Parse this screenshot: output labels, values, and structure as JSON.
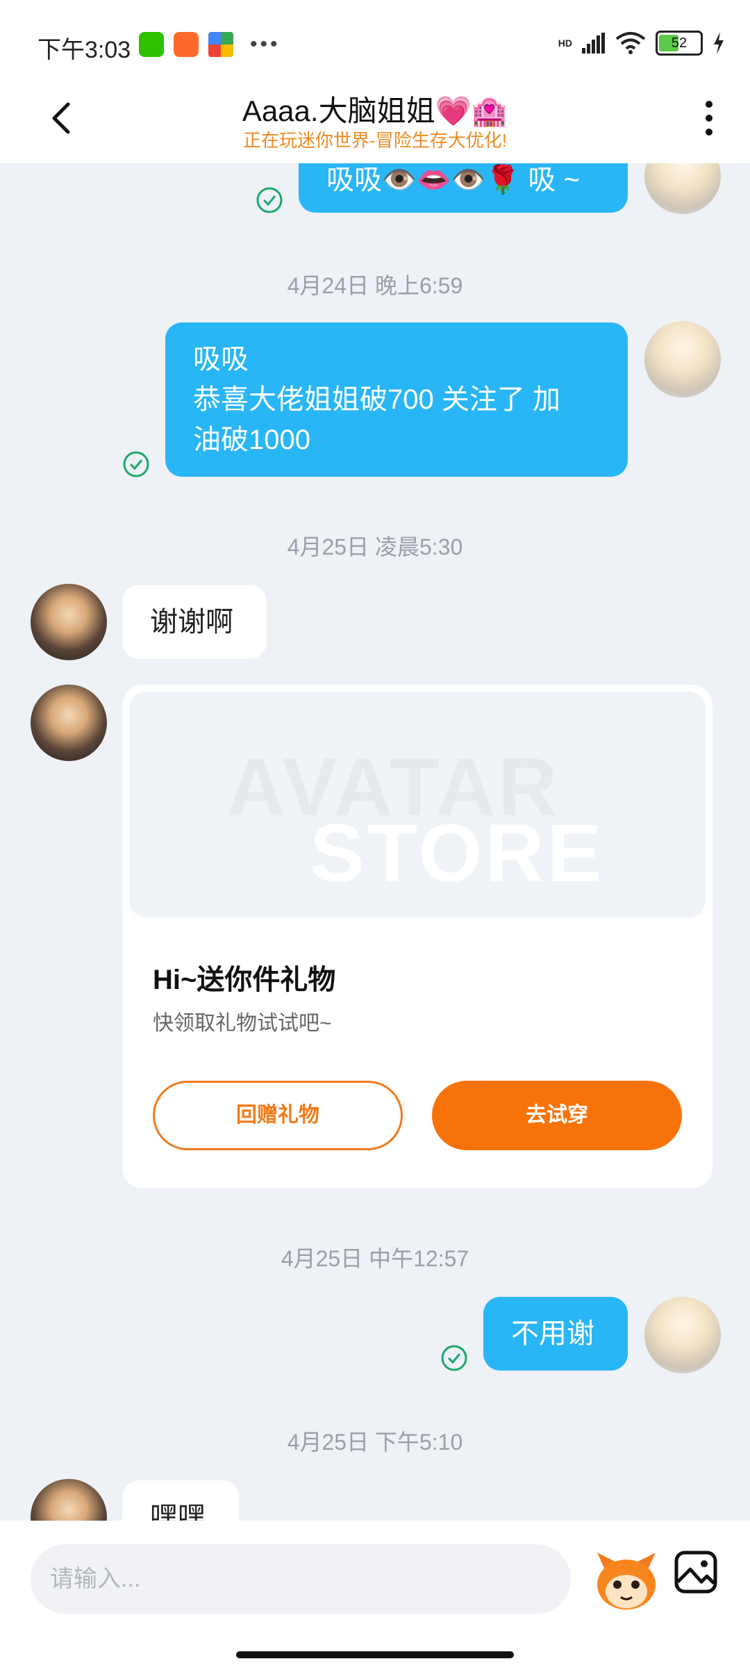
{
  "status_bar": {
    "time": "下午3:03",
    "network": "HD",
    "battery": "52",
    "battery_level": 0.52
  },
  "header": {
    "title": "Aaaa.大脑姐姐💗🏩",
    "subtitle": "正在玩迷你世界-冒险生存大优化!"
  },
  "messages": {
    "m0": {
      "text": "吸吸👁️👄👁️🌹 吸 ~"
    },
    "t1": "4月24日 晚上6:59",
    "m1": {
      "line1": "吸吸",
      "line2": "恭喜大佬姐姐破700 关注了 加",
      "line3": "油破1000"
    },
    "t2": "4月25日 凌晨5:30",
    "m2": {
      "text": "谢谢啊"
    },
    "gift": {
      "title": "Hi~送你件礼物",
      "subtitle": "快领取礼物试试吧~",
      "image_line1": "AVATAR",
      "image_line2": "STORE",
      "return_gift": "回赠礼物",
      "try_on": "去试穿"
    },
    "t3": "4月25日 中午12:57",
    "m3": {
      "text": "不用谢"
    },
    "t4": "4月25日 下午5:10",
    "m4": {
      "text": "嘿嘿"
    }
  },
  "input": {
    "placeholder": "请输入..."
  },
  "colors": {
    "accent_orange": "#f7730a",
    "bubble_blue": "#29b6f6",
    "read_check": "#1aa86a"
  }
}
